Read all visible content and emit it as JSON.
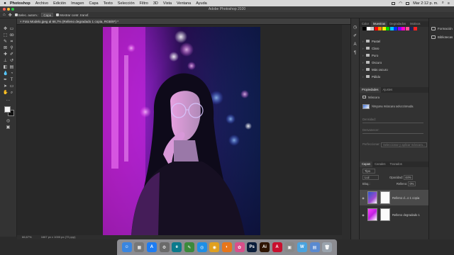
{
  "menubar": {
    "apple": "",
    "app": "Photoshop",
    "items": [
      "Archivo",
      "Edición",
      "Imagen",
      "Capa",
      "Texto",
      "Selección",
      "Filtro",
      "3D",
      "Vista",
      "Ventana",
      "Ayuda"
    ],
    "clock": "Mar 2:12 p. m."
  },
  "window": {
    "title": "Adobe Photoshop 2020"
  },
  "options_bar": {
    "mode": "Selec. autom.:",
    "target": "Capa",
    "transform": "Mostrar contr. transf."
  },
  "document": {
    "tab_title": "Foto Modelo.jpeg al 66,7% (Relleno degradado 1 copia, RGB/8*) *",
    "zoom": "66,67%",
    "doc_size": "1667 px x 1000 px (72 ppp)"
  },
  "swatches_panel": {
    "tabs": [
      "Color",
      "Muestras",
      "Degradados",
      "Motivos"
    ],
    "active_tab": "Muestras",
    "swatch_colors": [
      "#000000",
      "#ffffff",
      "#c8c8c8",
      "#ff0000",
      "#ff8a00",
      "#ffee00",
      "#00d000",
      "#00c8ff",
      "#0030ff",
      "#8a00ff",
      "#ff00c8",
      "#ff5090",
      "#202060",
      "#ff2020"
    ],
    "folders": [
      "Pastel",
      "Claro",
      "Puro",
      "Oscuro",
      "Más oscuro",
      "Pálido"
    ]
  },
  "properties_panel": {
    "tabs": [
      "Propiedades",
      "Ajustes"
    ],
    "active_tab": "Propiedades",
    "mask_type": "Máscara",
    "mask_status": "Ninguna máscara seleccionada",
    "density_label": "Densidad:",
    "feather_label": "Desvanecer:",
    "refine_label": "Perfeccionar:",
    "select_mask_button": "Seleccionar y aplicar máscara..."
  },
  "layers_panel": {
    "tabs": [
      "Capas",
      "Canales",
      "Trazados"
    ],
    "active_tab": "Capas",
    "filter": "Tipo",
    "blend_mode": "Luz",
    "opacity_label": "Opacidad:",
    "opacity": "44%",
    "lock_label": "Bloq.:",
    "fill_label": "Relleno:",
    "fill": "0%",
    "layers": [
      {
        "name": "Relleno d...o 1 copia",
        "selected": true,
        "visible": true
      },
      {
        "name": "Relleno degradado 1",
        "selected": false,
        "visible": true
      }
    ]
  },
  "side_panel": {
    "items": [
      "Formación",
      "Bibliotecas"
    ]
  },
  "dock": {
    "apps": [
      {
        "name": "Finder",
        "color": "#3a86e0",
        "glyph": "☺"
      },
      {
        "name": "Launchpad",
        "color": "#777777",
        "glyph": "▦"
      },
      {
        "name": "App Store",
        "color": "#1e7cf2",
        "glyph": "A"
      },
      {
        "name": "Preferencias del Sistema",
        "color": "#6a6a6a",
        "glyph": "⚙"
      },
      {
        "name": "Edge",
        "color": "#0b7a8c",
        "glyph": "e"
      },
      {
        "name": "Vista previa",
        "color": "#3b8a3b",
        "glyph": "✎"
      },
      {
        "name": "Safari",
        "color": "#1f8fe6",
        "glyph": "◎"
      },
      {
        "name": "Chrome",
        "color": "#e0a020",
        "glyph": "◉"
      },
      {
        "name": "Blender",
        "color": "#e8761a",
        "glyph": "◐"
      },
      {
        "name": "Fotos",
        "color": "#d94f8a",
        "glyph": "✿"
      },
      {
        "name": "Photoshop",
        "color": "#0b1e3b",
        "glyph": "Ps"
      },
      {
        "name": "Illustrator",
        "color": "#2e1400",
        "glyph": "Ai"
      },
      {
        "name": "Acrobat",
        "color": "#c8102e",
        "glyph": "A"
      },
      {
        "name": "Visor",
        "color": "#888888",
        "glyph": "▣"
      },
      {
        "name": "Notas",
        "color": "#4aa3df",
        "glyph": "W"
      },
      {
        "name": "Documentos",
        "color": "#5a8ad0",
        "glyph": "▤"
      },
      {
        "name": "Papelera",
        "color": "#9aa3ad",
        "glyph": "🗑"
      }
    ]
  },
  "colors": {
    "foreground": "#f5f5f5",
    "background": "#111111"
  }
}
